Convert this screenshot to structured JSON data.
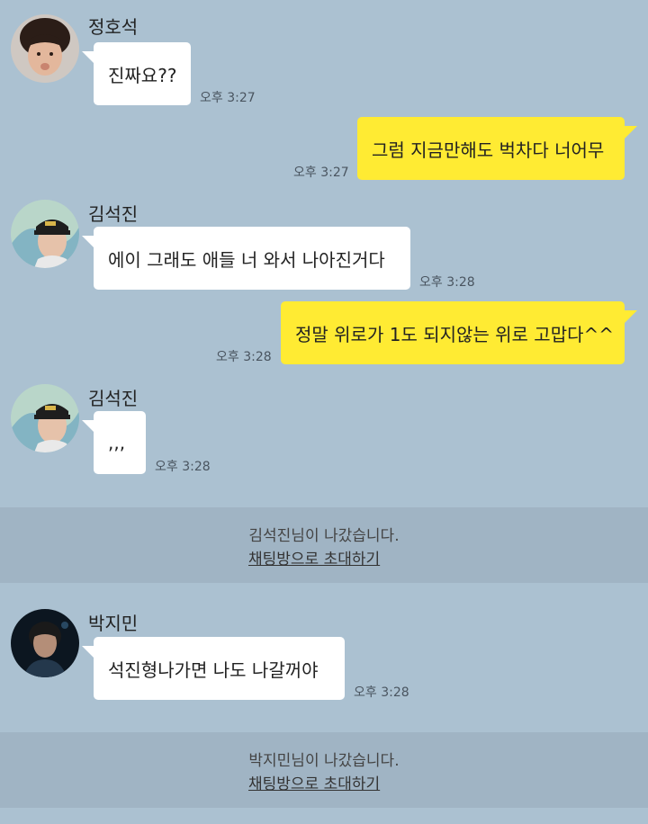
{
  "messages": [
    {
      "sender": "정호석",
      "text": "진짜요??",
      "time": "오후 3:27"
    },
    {
      "text": "그럼 지금만해도 벅차다 너어무",
      "time": "오후 3:27"
    },
    {
      "sender": "김석진",
      "text": "에이 그래도 애들 너 와서 나아진거다",
      "time": "오후 3:28"
    },
    {
      "text": "정말 위로가 1도 되지않는 위로 고맙다^^",
      "time": "오후 3:28"
    },
    {
      "sender": "김석진",
      "text": ",,,",
      "time": "오후 3:28"
    },
    {
      "sender": "박지민",
      "text": "석진형나가면 나도 나갈꺼야",
      "time": "오후 3:28"
    }
  ],
  "system": [
    {
      "notice": "김석진님이 나갔습니다.",
      "invite_label": "채팅방으로 초대하기"
    },
    {
      "notice": "박지민님이 나갔습니다.",
      "invite_label": "채팅방으로 초대하기"
    }
  ],
  "colors": {
    "background": "#abc1d1",
    "system_band": "#a0b4c4",
    "my_bubble": "#ffeb33",
    "other_bubble": "#ffffff"
  }
}
